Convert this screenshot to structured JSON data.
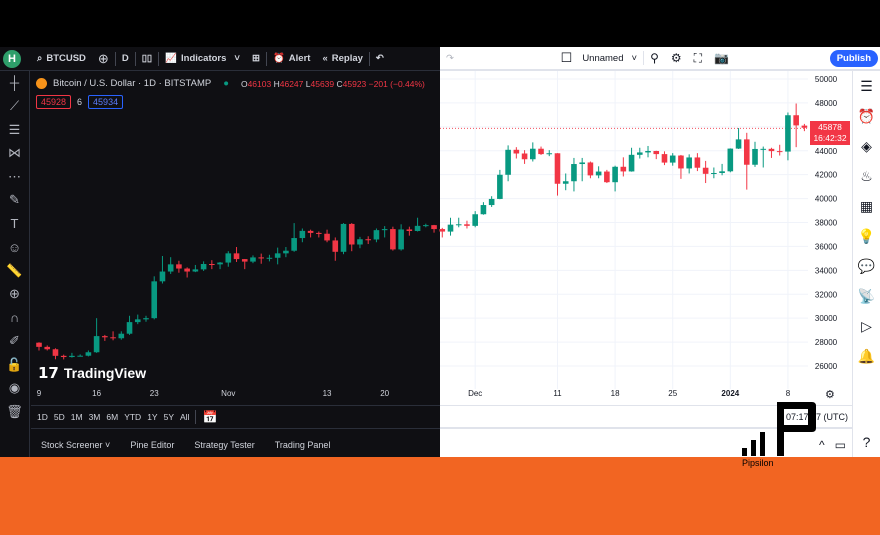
{
  "toolbar": {
    "avatar_letter": "H",
    "symbol": "BTCUSD",
    "interval": "D",
    "indicators": "Indicators",
    "alert": "Alert",
    "replay": "Replay",
    "layout_name": "Unnamed",
    "publish": "Publish"
  },
  "legend": {
    "title": "Bitcoin / U.S. Dollar · 1D · BITSTAMP",
    "o_label": "O",
    "o": "46103",
    "h_label": "H",
    "h": "46247",
    "l_label": "L",
    "l": "45639",
    "c_label": "C",
    "c": "45923",
    "change": "−201 (−0.44%)",
    "bid": "45928",
    "spread": "6",
    "ask": "45934"
  },
  "price_label": {
    "price": "45878",
    "countdown": "16:42:32"
  },
  "branding": {
    "tradingview": "TradingView",
    "watermark": "Pipsilon"
  },
  "colors": {
    "up": "#089981",
    "down": "#f23645",
    "accent": "#2962ff",
    "orange_band": "#f26522"
  },
  "range_buttons": [
    "1D",
    "5D",
    "1M",
    "3M",
    "6M",
    "YTD",
    "1Y",
    "5Y",
    "All"
  ],
  "clock": "07:17:27 (UTC)",
  "bottom_tabs": [
    "Stock Screener",
    "Pine Editor",
    "Strategy Tester",
    "Trading Panel"
  ],
  "chart_data": {
    "type": "candlestick",
    "start_date": "2023-10-08",
    "y_ticks": [
      26000,
      28000,
      30000,
      32000,
      34000,
      36000,
      38000,
      40000,
      42000,
      44000,
      46000,
      48000,
      50000
    ],
    "x_ticks": [
      {
        "label": "9",
        "day": 1
      },
      {
        "label": "16",
        "day": 8
      },
      {
        "label": "23",
        "day": 15
      },
      {
        "label": "Nov",
        "day": 24
      },
      {
        "label": "13",
        "day": 36
      },
      {
        "label": "20",
        "day": 43
      },
      {
        "label": "Dec",
        "day": 54
      },
      {
        "label": "11",
        "day": 64
      },
      {
        "label": "18",
        "day": 71
      },
      {
        "label": "25",
        "day": 78
      },
      {
        "label": "2024",
        "day": 85
      },
      {
        "label": "8",
        "day": 92
      }
    ],
    "last_price": 45878,
    "ohlc": [
      [
        27950,
        28100,
        27800,
        27950
      ],
      [
        27950,
        27990,
        27300,
        27600
      ],
      [
        27600,
        27720,
        27300,
        27400
      ],
      [
        27400,
        27480,
        26560,
        26850
      ],
      [
        26850,
        26950,
        26550,
        26750
      ],
      [
        26750,
        27100,
        26700,
        26850
      ],
      [
        26850,
        26970,
        26810,
        26860
      ],
      [
        26860,
        27300,
        26800,
        27150
      ],
      [
        27150,
        30000,
        27100,
        28500
      ],
      [
        28500,
        28600,
        28100,
        28400
      ],
      [
        28400,
        28900,
        28150,
        28320
      ],
      [
        28320,
        28900,
        28200,
        28700
      ],
      [
        28700,
        30200,
        28600,
        29670
      ],
      [
        29670,
        30300,
        29500,
        29900
      ],
      [
        29900,
        30200,
        29700,
        30000
      ],
      [
        30000,
        33500,
        29900,
        33080
      ],
      [
        33080,
        35200,
        32900,
        33900
      ],
      [
        33900,
        35100,
        33700,
        34500
      ],
      [
        34500,
        34800,
        33800,
        34150
      ],
      [
        34150,
        34250,
        33400,
        33900
      ],
      [
        33900,
        34450,
        33850,
        34080
      ],
      [
        34080,
        34750,
        33950,
        34530
      ],
      [
        34530,
        34850,
        34100,
        34500
      ],
      [
        34500,
        34700,
        34100,
        34650
      ],
      [
        34650,
        35600,
        34300,
        35420
      ],
      [
        35420,
        35950,
        34700,
        34940
      ],
      [
        34940,
        34950,
        34100,
        34730
      ],
      [
        34730,
        35250,
        34600,
        35080
      ],
      [
        35080,
        35400,
        34550,
        35050
      ],
      [
        35050,
        35300,
        34750,
        35050
      ],
      [
        35050,
        35900,
        34500,
        35420
      ],
      [
        35420,
        35950,
        35100,
        35640
      ],
      [
        35640,
        37950,
        35550,
        36700
      ],
      [
        36700,
        37500,
        36350,
        37300
      ],
      [
        37300,
        37400,
        36750,
        37130
      ],
      [
        37130,
        37250,
        36750,
        37060
      ],
      [
        37060,
        37400,
        36350,
        36500
      ],
      [
        36500,
        36750,
        34800,
        35550
      ],
      [
        35550,
        37950,
        35350,
        37880
      ],
      [
        37880,
        37950,
        35600,
        36160
      ],
      [
        36160,
        36800,
        35850,
        36600
      ],
      [
        36600,
        36850,
        36200,
        36580
      ],
      [
        36580,
        37500,
        36350,
        37360
      ],
      [
        37360,
        37700,
        36750,
        37450
      ],
      [
        37450,
        37650,
        35650,
        35750
      ],
      [
        35750,
        37850,
        35650,
        37420
      ],
      [
        37420,
        37650,
        36900,
        37290
      ],
      [
        37290,
        38400,
        37250,
        37720
      ],
      [
        37720,
        37900,
        37600,
        37780
      ],
      [
        37780,
        37800,
        37150,
        37450
      ],
      [
        37450,
        37550,
        36750,
        37240
      ],
      [
        37240,
        38400,
        36900,
        37820
      ],
      [
        37820,
        38400,
        37600,
        37850
      ],
      [
        37850,
        38150,
        37500,
        37720
      ],
      [
        37720,
        38950,
        37600,
        38690
      ],
      [
        38690,
        39700,
        38650,
        39460
      ],
      [
        39460,
        40200,
        39300,
        39970
      ],
      [
        39970,
        42400,
        39950,
        41990
      ],
      [
        41990,
        44450,
        41450,
        44080
      ],
      [
        44080,
        44300,
        43350,
        43770
      ],
      [
        43770,
        44050,
        42900,
        43290
      ],
      [
        43290,
        44700,
        43100,
        44170
      ],
      [
        44170,
        44350,
        43650,
        43720
      ],
      [
        43720,
        44050,
        43550,
        43790
      ],
      [
        43790,
        43800,
        40250,
        41240
      ],
      [
        41240,
        42100,
        40700,
        41450
      ],
      [
        41450,
        43400,
        40600,
        42890
      ],
      [
        42890,
        43400,
        41450,
        43020
      ],
      [
        43020,
        43100,
        41700,
        41940
      ],
      [
        41940,
        42700,
        41700,
        42260
      ],
      [
        42260,
        42400,
        41300,
        41370
      ],
      [
        41370,
        42750,
        40600,
        42660
      ],
      [
        42660,
        43450,
        41850,
        42270
      ],
      [
        42270,
        44250,
        42250,
        43660
      ],
      [
        43660,
        44250,
        43350,
        43860
      ],
      [
        43860,
        44400,
        43450,
        43980
      ],
      [
        43980,
        44000,
        43300,
        43720
      ],
      [
        43720,
        43950,
        42800,
        43010
      ],
      [
        43010,
        43800,
        42750,
        43600
      ],
      [
        43600,
        43650,
        41650,
        42520
      ],
      [
        42520,
        43700,
        42100,
        43440
      ],
      [
        43440,
        43800,
        42300,
        42580
      ],
      [
        42580,
        43150,
        41300,
        42070
      ],
      [
        42070,
        42600,
        41700,
        42140
      ],
      [
        42140,
        42900,
        41950,
        42280
      ],
      [
        42280,
        44200,
        42200,
        44180
      ],
      [
        44180,
        45900,
        44150,
        44950
      ],
      [
        44950,
        45500,
        40750,
        42830
      ],
      [
        42830,
        44750,
        42650,
        44150
      ],
      [
        44150,
        44350,
        42600,
        44160
      ],
      [
        44160,
        44250,
        43400,
        43970
      ],
      [
        43970,
        44500,
        43600,
        43930
      ],
      [
        43930,
        47200,
        43200,
        46970
      ],
      [
        46970,
        47950,
        44300,
        46120
      ],
      [
        46103,
        46247,
        45639,
        45923
      ]
    ]
  }
}
